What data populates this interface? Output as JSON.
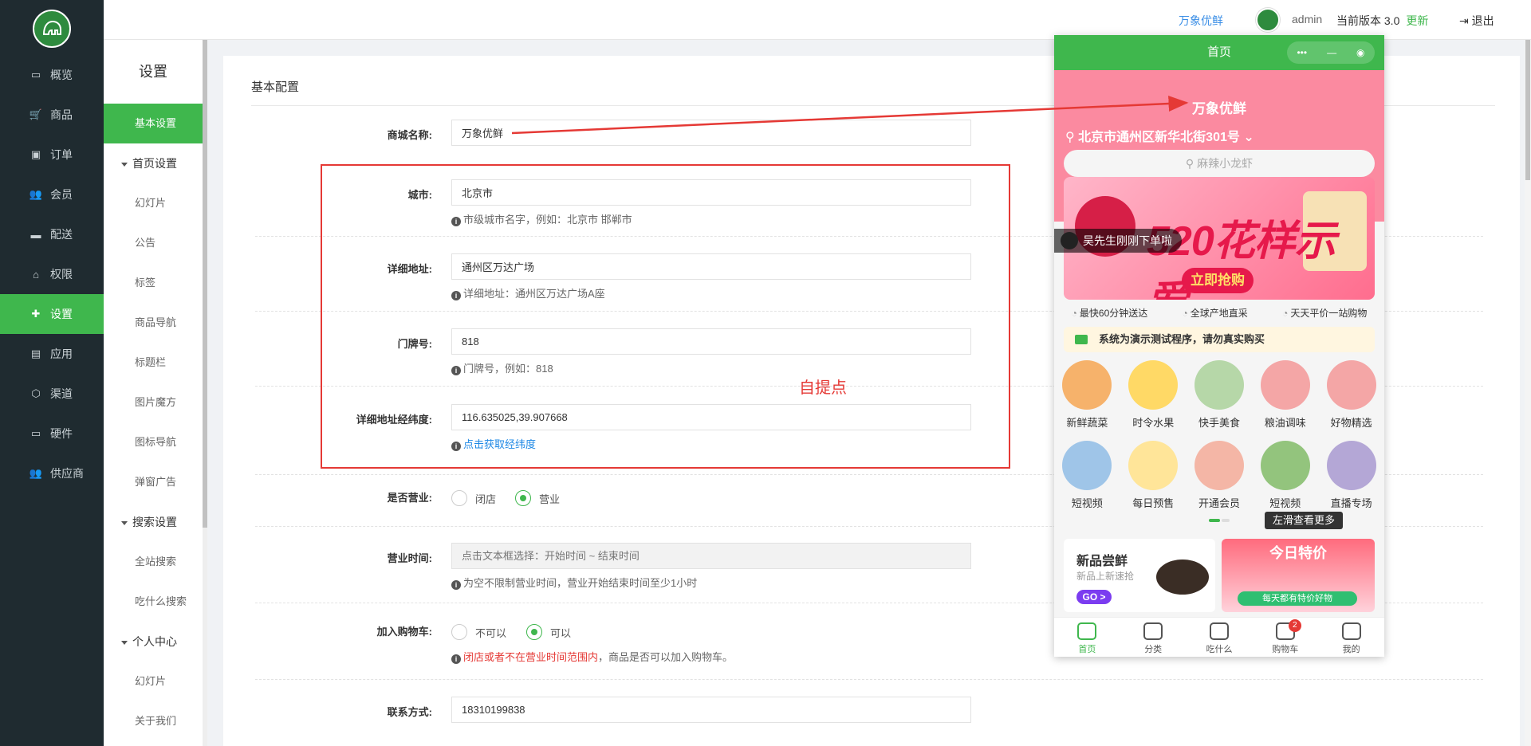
{
  "header": {
    "brand": "万象优鲜",
    "user": "admin",
    "version_label": "当前版本 3.0",
    "update_link": "更新",
    "logout": "退出"
  },
  "logo_text": "万象优鲜",
  "nav": [
    {
      "label": "概览",
      "icon": "monitor-icon"
    },
    {
      "label": "商品",
      "icon": "cart-icon"
    },
    {
      "label": "订单",
      "icon": "order-icon"
    },
    {
      "label": "会员",
      "icon": "users-icon"
    },
    {
      "label": "配送",
      "icon": "truck-icon"
    },
    {
      "label": "权限",
      "icon": "bank-icon"
    },
    {
      "label": "设置",
      "icon": "puzzle-icon",
      "active": true
    },
    {
      "label": "应用",
      "icon": "app-icon"
    },
    {
      "label": "渠道",
      "icon": "cube-icon"
    },
    {
      "label": "硬件",
      "icon": "desktop-icon"
    },
    {
      "label": "供应商",
      "icon": "supplier-icon"
    }
  ],
  "subnav": {
    "title": "设置",
    "items": [
      {
        "label": "基本设置",
        "type": "item",
        "active": true
      },
      {
        "label": "首页设置",
        "type": "group"
      },
      {
        "label": "幻灯片",
        "type": "item"
      },
      {
        "label": "公告",
        "type": "item"
      },
      {
        "label": "标签",
        "type": "item"
      },
      {
        "label": "商品导航",
        "type": "item"
      },
      {
        "label": "标题栏",
        "type": "item"
      },
      {
        "label": "图片魔方",
        "type": "item"
      },
      {
        "label": "图标导航",
        "type": "item"
      },
      {
        "label": "弹窗广告",
        "type": "item"
      },
      {
        "label": "搜索设置",
        "type": "group"
      },
      {
        "label": "全站搜索",
        "type": "item"
      },
      {
        "label": "吃什么搜索",
        "type": "item"
      },
      {
        "label": "个人中心",
        "type": "group"
      },
      {
        "label": "幻灯片",
        "type": "item"
      },
      {
        "label": "关于我们",
        "type": "item"
      }
    ]
  },
  "form": {
    "title": "基本配置",
    "shop_name": {
      "label": "商城名称:",
      "value": "万象优鲜"
    },
    "city": {
      "label": "城市:",
      "value": "北京市",
      "tip": "市级城市名字，例如：北京市 邯郸市"
    },
    "address": {
      "label": "详细地址:",
      "value": "通州区万达广场",
      "tip": "详细地址：通州区万达广场A座"
    },
    "door": {
      "label": "门牌号:",
      "value": "818",
      "tip": "门牌号，例如：818"
    },
    "latlng": {
      "label": "详细地址经纬度:",
      "value": "116.635025,39.907668",
      "tip_link": "点击获取经纬度"
    },
    "open": {
      "label": "是否营业:",
      "opt1": "闭店",
      "opt2": "营业",
      "selected": "营业"
    },
    "hours": {
      "label": "营业时间:",
      "placeholder": "点击文本框选择：开始时间 ~ 结束时间",
      "tip": "为空不限制营业时间，营业开始结束时间至少1小时"
    },
    "cart": {
      "label": "加入购物车:",
      "opt1": "不可以",
      "opt2": "可以",
      "selected": "可以",
      "tip_red": "闭店或者不在营业时间范围内",
      "tip_rest": "，商品是否可以加入购物车。"
    },
    "contact": {
      "label": "联系方式:",
      "value": "18310199838"
    }
  },
  "annotation": {
    "pickup_label": "自提点",
    "color": "#e53935"
  },
  "phone": {
    "title": "首页",
    "shop_name": "万象优鲜",
    "location": "北京市通州区新华北街301号",
    "search_placeholder": "麻辣小龙虾",
    "banner_title": "520花样示爱",
    "banner_button": "立即抢购",
    "order_tip": "吴先生刚刚下单啦",
    "badges": [
      "最快60分钟送达",
      "全球产地直采",
      "天天平价一站购物"
    ],
    "notice": "系统为演示测试程序，请勿真实购买",
    "categories": [
      {
        "label": "新鲜蔬菜",
        "color": "#f6b26b"
      },
      {
        "label": "时令水果",
        "color": "#ffd966"
      },
      {
        "label": "快手美食",
        "color": "#b6d7a8"
      },
      {
        "label": "粮油调味",
        "color": "#f4a6a6"
      },
      {
        "label": "好物精选",
        "color": "#f4a6a6"
      },
      {
        "label": "短视频",
        "color": "#9fc5e8"
      },
      {
        "label": "每日预售",
        "color": "#ffe599"
      },
      {
        "label": "开通会员",
        "color": "#f4b6a6"
      },
      {
        "label": "短视频",
        "color": "#93c47d"
      },
      {
        "label": "直播专场",
        "color": "#b4a7d6"
      }
    ],
    "swipe_hint": "左滑查看更多",
    "new_card": {
      "title": "新品尝鲜",
      "subtitle": "新品上新速抢",
      "go": "GO >"
    },
    "sale_card": {
      "title": "今日特价",
      "subtitle": "每天都有特价好物"
    },
    "tabs": [
      {
        "label": "首页",
        "active": true
      },
      {
        "label": "分类"
      },
      {
        "label": "吃什么"
      },
      {
        "label": "购物车",
        "badge": "2"
      },
      {
        "label": "我的"
      }
    ],
    "accent": "#3fb74d",
    "header_color": "#fb8aa0"
  }
}
